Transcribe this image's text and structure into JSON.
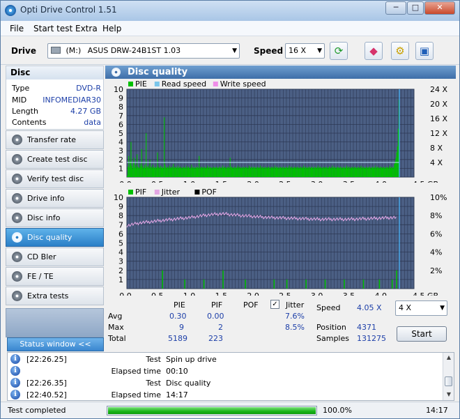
{
  "window": {
    "title": "Opti Drive Control 1.51",
    "minimize": "─",
    "maximize": "□",
    "close": "✕"
  },
  "menu": [
    "File",
    "Start test",
    "Extra",
    "Help"
  ],
  "toolbar": {
    "drive_label": "Drive",
    "drive_letter": "(M:)",
    "drive_name": "ASUS DRW-24B1ST 1.03",
    "speed_label": "Speed",
    "speed_value": "16 X",
    "icons": [
      "refresh-icon",
      "eraser-icon",
      "gear-icon",
      "save-icon"
    ]
  },
  "disc": {
    "header": "Disc",
    "rows": [
      {
        "key": "Type",
        "value": "DVD-R"
      },
      {
        "key": "MID",
        "value": "INFOMEDIAR30"
      },
      {
        "key": "Length",
        "value": "4.27 GB"
      },
      {
        "key": "Contents",
        "value": "data"
      }
    ]
  },
  "sidebar": {
    "items": [
      "Transfer rate",
      "Create test disc",
      "Verify test disc",
      "Drive info",
      "Disc info",
      "Disc quality",
      "CD Bler",
      "FE / TE",
      "Extra tests"
    ],
    "active": "Disc quality",
    "status_window": "Status window <<"
  },
  "panel": {
    "title": "Disc quality"
  },
  "chart_data": [
    {
      "type": "bar",
      "legend": [
        "PIE",
        "Read speed",
        "Write speed"
      ],
      "colors": {
        "PIE": "#00c000",
        "Read speed": "#7ac6ea",
        "Write speed": "#f08ee8"
      },
      "x_ticks": [
        "0.0",
        "0.5",
        "1.0",
        "1.5",
        "2.0",
        "2.5",
        "3.0",
        "3.5",
        "4.0",
        "4.5 GB"
      ],
      "xlim": [
        0,
        4.5
      ],
      "y_left_ticks": [
        "1",
        "2",
        "3",
        "4",
        "5",
        "6",
        "7",
        "8",
        "9",
        "10"
      ],
      "ylim": [
        0,
        10
      ],
      "y_right_ticks": [
        "4 X",
        "8 X",
        "12 X",
        "16 X",
        "20 X",
        "24 X"
      ],
      "y_right_lim": [
        0,
        24
      ],
      "read_speed_x": 4.05,
      "pie_values": [
        0.15,
        1.2,
        2.4,
        1.1,
        1.8,
        4,
        1.3,
        1.0,
        1.6,
        2.2,
        1.1,
        1.4,
        1.0,
        2.6,
        1.2,
        1.1,
        1.0,
        1.5,
        1.2,
        3.2,
        1.3,
        1.0,
        1.1,
        1.4,
        1.0,
        5,
        1.2,
        1.1,
        1.3,
        1.0,
        2.0,
        1.1,
        1.2,
        1.0,
        1.4,
        1.1,
        1.0,
        1.2,
        1.1,
        1.0,
        2.8,
        1.2,
        1.0,
        1.1,
        1.3,
        1.0,
        1.2,
        1.1,
        1.0,
        6.8,
        1.4,
        1.1,
        1.0,
        1.2,
        1.1,
        1.0,
        1.3,
        1.1,
        1.0,
        1.2,
        1.1,
        1.5,
        1.0,
        1.1,
        1.2,
        1.0,
        1.1,
        1.3,
        1.0,
        1.1,
        1.2,
        1.0,
        1.1,
        1.0,
        1.2,
        1.1,
        1.0,
        1.1,
        1.3,
        1.0,
        1.1,
        1.2,
        1.0,
        1.1,
        1.0,
        1.4,
        1.1,
        1.0,
        1.2,
        1.0,
        1.1,
        1.0,
        1.2,
        1.1,
        1.0,
        2.4,
        1.1,
        1.0,
        1.2,
        1.1,
        1.0,
        1.1,
        1.2,
        1.0,
        1.1,
        1.0,
        1.3,
        1.1,
        1.0,
        1.2,
        1.1,
        1.0,
        1.1,
        1.0,
        1.2,
        1.1,
        1.0,
        1.1,
        1.2,
        1.0,
        1.1,
        1.0,
        1.2,
        1.1,
        1.0,
        1.1,
        1.3,
        1.0,
        1.1,
        1.2,
        1.0,
        1.1,
        1.0,
        1.2,
        1.1,
        1.0,
        2.2,
        1.1,
        1.2,
        1.0,
        1.1,
        1.0,
        1.2,
        1.1,
        1.0,
        1.1,
        1.3,
        1.0,
        1.1,
        1.2,
        1.0,
        1.1,
        1.0,
        1.2,
        1.1,
        1.0,
        1.1,
        1.2,
        1.0,
        1.1,
        1.0,
        1.3,
        1.1,
        1.0,
        1.2,
        1.1,
        1.0,
        1.1,
        1.2,
        1.0,
        1.1,
        1.0,
        1.2,
        1.1,
        1.0,
        1.1,
        1.3,
        1.0,
        1.1,
        1.2,
        1.0,
        1.1,
        1.0,
        1.2,
        1.1,
        1.0,
        1.1,
        1.2,
        1.0,
        1.1,
        1.0,
        1.2,
        1.1,
        1.0,
        1.1,
        1.3,
        1.0,
        1.1,
        1.2,
        1.0,
        1.1,
        1.0,
        1.2,
        1.1,
        1.0,
        1.1,
        1.2,
        1.0,
        1.1,
        1.0,
        1.2,
        1.1,
        1.0,
        1.1,
        1.3,
        1.0,
        1.1,
        1.2,
        1.0,
        1.1,
        1.0,
        1.2,
        1.1,
        1.0,
        1.1,
        1.2,
        1.0,
        1.1,
        1.0,
        1.2,
        1.1,
        1.0,
        1.1,
        1.3,
        1.0,
        1.1,
        1.2,
        1.0,
        1.1,
        1.0,
        1.2,
        1.1,
        1.0,
        1.1,
        1.2,
        1.0,
        1.1,
        1.0,
        1.2,
        1.1,
        1.0,
        1.1,
        1.3,
        1.0,
        1.1,
        1.2,
        1.0,
        1.1,
        1.0,
        1.2,
        1.1,
        1.0,
        1.1,
        1.2,
        1.0,
        1.1,
        1.0,
        1.2,
        1.1,
        1.0,
        1.1,
        1.3,
        1.0,
        1.1,
        1.2,
        1.0,
        1.1,
        1.0,
        1.2,
        1.1,
        1.0,
        1.1,
        1.2,
        1.0,
        1.1,
        1.0,
        1.2,
        1.1,
        1.0,
        1.1,
        1.3,
        1.0,
        1.1,
        1.2,
        1.0,
        1.1,
        1.0,
        1.2,
        1.1,
        1.0,
        1.1,
        1.2,
        1.0,
        1.1,
        1.0,
        1.2,
        1.1,
        1.0,
        1.1,
        1.3,
        1.0,
        1.1,
        1.2,
        1.0,
        1.1,
        1.0,
        1.2,
        1.1,
        1.0,
        1.1,
        1.2,
        1.0,
        1.1,
        1.0,
        1.2,
        1.1,
        1.0,
        1.1,
        1.3,
        1.0,
        1.1,
        1.2,
        1.0,
        1.1,
        1.0,
        1.2,
        1.1,
        1.0,
        1.1,
        1.2,
        1.0,
        1.1,
        1.0,
        1.2,
        1.1,
        1.0,
        1.1,
        1.3,
        1.0,
        1.1,
        1.2,
        1.0,
        1.1,
        1.5,
        1.8,
        2.2,
        2.8,
        3.5,
        5.5,
        8.8
      ]
    },
    {
      "type": "bar",
      "legend": [
        "PIF",
        "Jitter",
        "POF"
      ],
      "colors": {
        "PIF": "#00c000",
        "Jitter": "#e3a6e3",
        "POF": "#000000"
      },
      "x_ticks": [
        "0.0",
        "0.5",
        "1.0",
        "1.5",
        "2.0",
        "2.5",
        "3.0",
        "3.5",
        "4.0",
        "4.5 GB"
      ],
      "xlim": [
        0,
        4.5
      ],
      "y_left_ticks": [
        "1",
        "2",
        "3",
        "4",
        "5",
        "6",
        "7",
        "8",
        "9",
        "10"
      ],
      "ylim": [
        0,
        10
      ],
      "y_right_ticks": [
        "2%",
        "4%",
        "6%",
        "8%",
        "10%"
      ],
      "y_right_lim": [
        0,
        10
      ],
      "read_speed_x": 4.05,
      "pif_points": [
        [
          0.55,
          2
        ],
        [
          0.9,
          1
        ],
        [
          1.2,
          1
        ],
        [
          1.5,
          2
        ],
        [
          1.85,
          1
        ],
        [
          2.3,
          1
        ],
        [
          2.5,
          1
        ],
        [
          2.8,
          1
        ],
        [
          3.1,
          1
        ],
        [
          3.4,
          1
        ],
        [
          3.7,
          1
        ],
        [
          3.95,
          1
        ],
        [
          4.15,
          1
        ],
        [
          4.22,
          2
        ]
      ],
      "jitter_profile": [
        [
          0.0,
          6.9
        ],
        [
          0.2,
          7.2
        ],
        [
          0.6,
          7.5
        ],
        [
          1.0,
          7.8
        ],
        [
          1.3,
          8.1
        ],
        [
          1.5,
          8.2
        ],
        [
          1.8,
          8.0
        ],
        [
          2.2,
          7.8
        ],
        [
          2.6,
          7.7
        ],
        [
          3.0,
          7.6
        ],
        [
          3.5,
          7.6
        ],
        [
          3.9,
          7.7
        ],
        [
          4.22,
          7.8
        ]
      ]
    }
  ],
  "stats": {
    "headers": [
      "PIE",
      "PIF",
      "POF",
      "Jitter"
    ],
    "rows": [
      {
        "label": "Avg",
        "pie": "0.30",
        "pif": "0.00",
        "jitter": "7.6%"
      },
      {
        "label": "Max",
        "pie": "9",
        "pif": "2",
        "jitter": "8.5%"
      },
      {
        "label": "Total",
        "pie": "5189",
        "pif": "223"
      }
    ],
    "jitter_checked": "✓",
    "speed_label": "Speed",
    "speed_value": "4.05 X",
    "speed_select": "4 X",
    "position_label": "Position",
    "position_value": "4371",
    "samples_label": "Samples",
    "samples_value": "131275",
    "start": "Start"
  },
  "log": [
    {
      "time": "[22:26.25]",
      "key": "Test",
      "value": "Spin up drive"
    },
    {
      "time": "",
      "key": "Elapsed time",
      "value": "00:10"
    },
    {
      "time": "[22:26.35]",
      "key": "Test",
      "value": "Disc quality"
    },
    {
      "time": "[22:40.52]",
      "key": "Elapsed time",
      "value": "14:17"
    }
  ],
  "status": {
    "text": "Test completed",
    "progress": 100,
    "progress_text": "100.0%",
    "time": "14:17"
  }
}
